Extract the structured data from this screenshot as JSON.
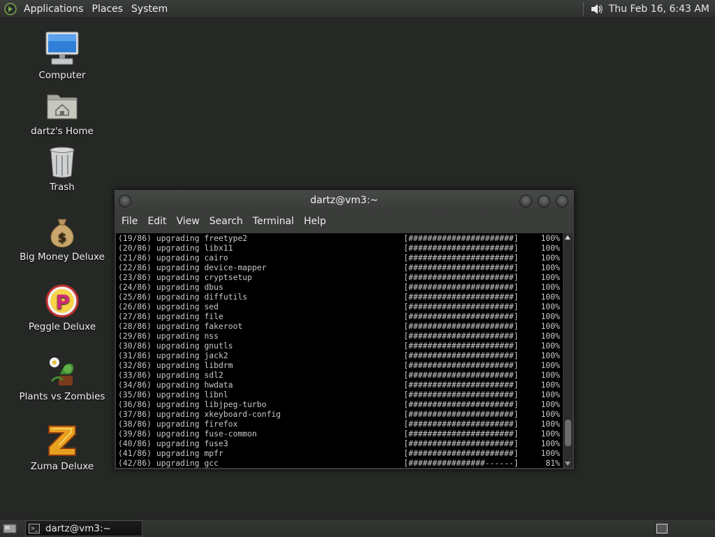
{
  "top_panel": {
    "menus": [
      "Applications",
      "Places",
      "System"
    ],
    "clock": "Thu Feb 16,  6:43 AM",
    "icons": [
      "distro-logo-icon",
      "volume-icon"
    ]
  },
  "desktop_icons": [
    {
      "label": "Computer",
      "icon": "computer-icon"
    },
    {
      "label": "dartz's Home",
      "icon": "home-folder-icon"
    },
    {
      "label": "Trash",
      "icon": "trash-icon"
    },
    {
      "label": "Big Money Deluxe",
      "icon": "money-bag-icon"
    },
    {
      "label": "Peggle Deluxe",
      "icon": "peggle-icon"
    },
    {
      "label": "Plants vs Zombies",
      "icon": "plants-vs-zombies-icon"
    },
    {
      "label": "Zuma Deluxe",
      "icon": "zuma-icon"
    }
  ],
  "terminal": {
    "title": "dartz@vm3:~",
    "menus": [
      "File",
      "Edit",
      "View",
      "Search",
      "Terminal",
      "Help"
    ],
    "lines": [
      {
        "step": "(19/86)",
        "action": "upgrading",
        "pkg": "freetype2",
        "bar": "[######################]",
        "pct": "100%"
      },
      {
        "step": "(20/86)",
        "action": "upgrading",
        "pkg": "libx11",
        "bar": "[######################]",
        "pct": "100%"
      },
      {
        "step": "(21/86)",
        "action": "upgrading",
        "pkg": "cairo",
        "bar": "[######################]",
        "pct": "100%"
      },
      {
        "step": "(22/86)",
        "action": "upgrading",
        "pkg": "device-mapper",
        "bar": "[######################]",
        "pct": "100%"
      },
      {
        "step": "(23/86)",
        "action": "upgrading",
        "pkg": "cryptsetup",
        "bar": "[######################]",
        "pct": "100%"
      },
      {
        "step": "(24/86)",
        "action": "upgrading",
        "pkg": "dbus",
        "bar": "[######################]",
        "pct": "100%"
      },
      {
        "step": "(25/86)",
        "action": "upgrading",
        "pkg": "diffutils",
        "bar": "[######################]",
        "pct": "100%"
      },
      {
        "step": "(26/86)",
        "action": "upgrading",
        "pkg": "sed",
        "bar": "[######################]",
        "pct": "100%"
      },
      {
        "step": "(27/86)",
        "action": "upgrading",
        "pkg": "file",
        "bar": "[######################]",
        "pct": "100%"
      },
      {
        "step": "(28/86)",
        "action": "upgrading",
        "pkg": "fakeroot",
        "bar": "[######################]",
        "pct": "100%"
      },
      {
        "step": "(29/86)",
        "action": "upgrading",
        "pkg": "nss",
        "bar": "[######################]",
        "pct": "100%"
      },
      {
        "step": "(30/86)",
        "action": "upgrading",
        "pkg": "gnutls",
        "bar": "[######################]",
        "pct": "100%"
      },
      {
        "step": "(31/86)",
        "action": "upgrading",
        "pkg": "jack2",
        "bar": "[######################]",
        "pct": "100%"
      },
      {
        "step": "(32/86)",
        "action": "upgrading",
        "pkg": "libdrm",
        "bar": "[######################]",
        "pct": "100%"
      },
      {
        "step": "(33/86)",
        "action": "upgrading",
        "pkg": "sdl2",
        "bar": "[######################]",
        "pct": "100%"
      },
      {
        "step": "(34/86)",
        "action": "upgrading",
        "pkg": "hwdata",
        "bar": "[######################]",
        "pct": "100%"
      },
      {
        "step": "(35/86)",
        "action": "upgrading",
        "pkg": "libnl",
        "bar": "[######################]",
        "pct": "100%"
      },
      {
        "step": "(36/86)",
        "action": "upgrading",
        "pkg": "libjpeg-turbo",
        "bar": "[######################]",
        "pct": "100%"
      },
      {
        "step": "(37/86)",
        "action": "upgrading",
        "pkg": "xkeyboard-config",
        "bar": "[######################]",
        "pct": "100%"
      },
      {
        "step": "(38/86)",
        "action": "upgrading",
        "pkg": "firefox",
        "bar": "[######################]",
        "pct": "100%"
      },
      {
        "step": "(39/86)",
        "action": "upgrading",
        "pkg": "fuse-common",
        "bar": "[######################]",
        "pct": "100%"
      },
      {
        "step": "(40/86)",
        "action": "upgrading",
        "pkg": "fuse3",
        "bar": "[######################]",
        "pct": "100%"
      },
      {
        "step": "(41/86)",
        "action": "upgrading",
        "pkg": "mpfr",
        "bar": "[######################]",
        "pct": "100%"
      },
      {
        "step": "(42/86)",
        "action": "upgrading",
        "pkg": "gcc",
        "bar": "[################------]",
        "pct": "81%"
      }
    ],
    "scroll_position_fraction": 0.93,
    "scroll_visible_fraction": 0.12
  },
  "bottom_panel": {
    "task_label": "dartz@vm3:~",
    "icons": [
      "show-desktop-icon",
      "terminal-task-icon",
      "workspace-switcher-icon"
    ]
  },
  "colors": {
    "desktop_bg": "#252825",
    "terminal_bg": "#000000",
    "terminal_fg": "#c8c8c8",
    "panel_bg": "#2e302e"
  }
}
